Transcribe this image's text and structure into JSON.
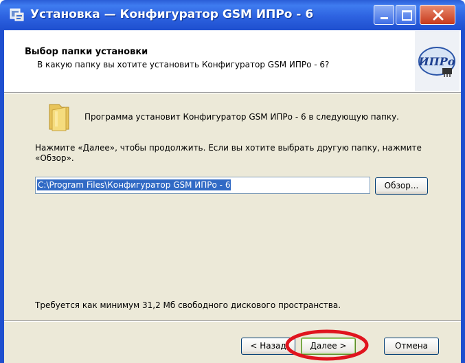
{
  "window": {
    "title": "Установка — Конфигуратор GSM ИПРо - 6",
    "controls": {
      "minimize": "minimize-icon",
      "maximize": "maximize-icon",
      "close": "close-icon"
    }
  },
  "header": {
    "title": "Выбор папки установки",
    "subtitle": "В какую папку вы хотите установить Конфигуратор GSM ИПРо - 6?",
    "logo_text": "ИПРо"
  },
  "body": {
    "intro": "Программа установит Конфигуратор GSM ИПРо - 6 в следующую папку.",
    "instructions": "Нажмите «Далее», чтобы продолжить. Если вы хотите выбрать другую папку, нажмите «Обзор».",
    "path_value": "C:\\Program Files\\Конфигуратор GSM ИПРо - 6",
    "browse_label": "Обзор...",
    "disk_space": "Требуется как минимум 31,2 Мб свободного дискового пространства."
  },
  "footer": {
    "back_label": "< Назад",
    "next_label": "Далее >",
    "cancel_label": "Отмена"
  },
  "colors": {
    "titlebar": "#2d62e0",
    "selection": "#316ac5",
    "dialog_bg": "#ece9d8",
    "highlight_ring": "#e0141e"
  }
}
